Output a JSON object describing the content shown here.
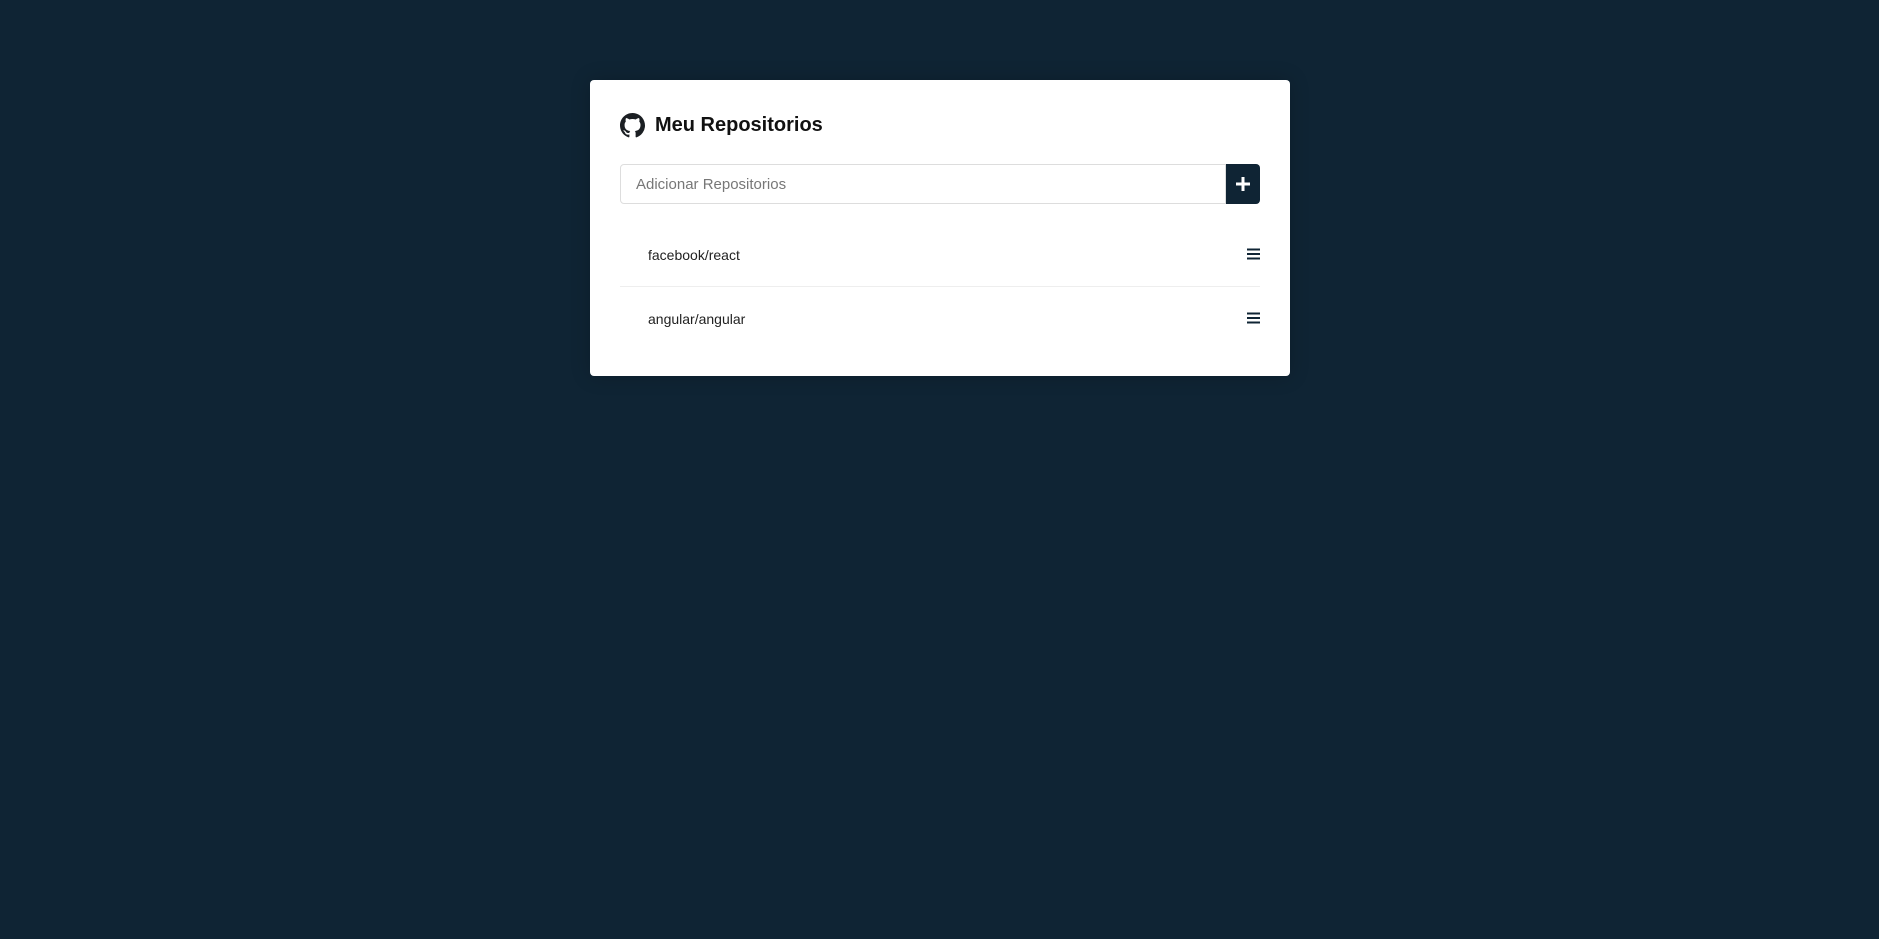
{
  "header": {
    "title": "Meu Repositorios",
    "icon": "github-icon"
  },
  "form": {
    "input_placeholder": "Adicionar Repositorios",
    "input_value": "",
    "add_button_icon": "plus-icon"
  },
  "repositories": [
    {
      "name": "facebook/react",
      "action_icon": "bars-icon"
    },
    {
      "name": "angular/angular",
      "action_icon": "bars-icon"
    }
  ],
  "colors": {
    "background": "#0f2434",
    "card": "#ffffff",
    "accent": "#0f2434"
  }
}
